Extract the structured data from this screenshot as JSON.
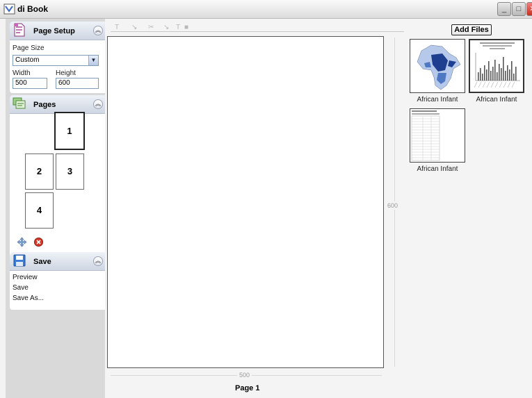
{
  "window": {
    "title": "di Book",
    "controls": {
      "minimize": "_",
      "maximize": "□",
      "close": "✕"
    }
  },
  "page_setup": {
    "title": "Page Setup",
    "collapse_icon": "chevron-double-up-icon",
    "page_size_label": "Page Size",
    "page_size_value": "Custom",
    "width_label": "Width",
    "height_label": "Height",
    "width_value": "500",
    "height_value": "600"
  },
  "pages": {
    "title": "Pages",
    "collapse_icon": "chevron-double-up-icon",
    "items": [
      "1",
      "2",
      "3",
      "4"
    ],
    "selected": "1",
    "actions": [
      "move-icon",
      "delete-icon"
    ]
  },
  "save": {
    "title": "Save",
    "collapse_icon": "chevron-double-up-icon",
    "items": [
      "Preview",
      "Save",
      "Save As..."
    ]
  },
  "canvas": {
    "height_ruler": "600",
    "width_ruler": "500",
    "page_label": "Page 1"
  },
  "files": {
    "add_button": "Add Files",
    "items": [
      {
        "label": "African Infant",
        "kind": "map"
      },
      {
        "label": "African Infant",
        "kind": "bar-chart",
        "selected": true
      },
      {
        "label": "African Infant",
        "kind": "table"
      }
    ]
  },
  "colors": {
    "map_dark": "#1e3f8f",
    "map_mid": "#4e78c4",
    "map_light": "#b7c9ea",
    "accent_close": "#c83020"
  }
}
